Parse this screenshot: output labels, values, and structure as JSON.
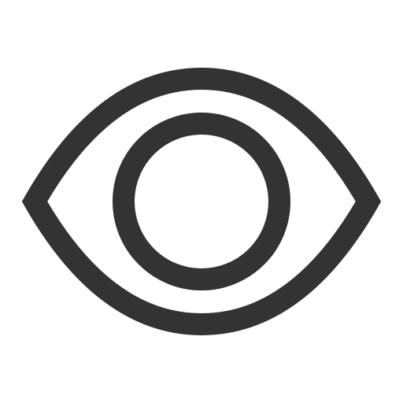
{
  "icon": {
    "name": "eye-icon",
    "stroke_color": "#333333",
    "background_color": "#ffffff"
  }
}
